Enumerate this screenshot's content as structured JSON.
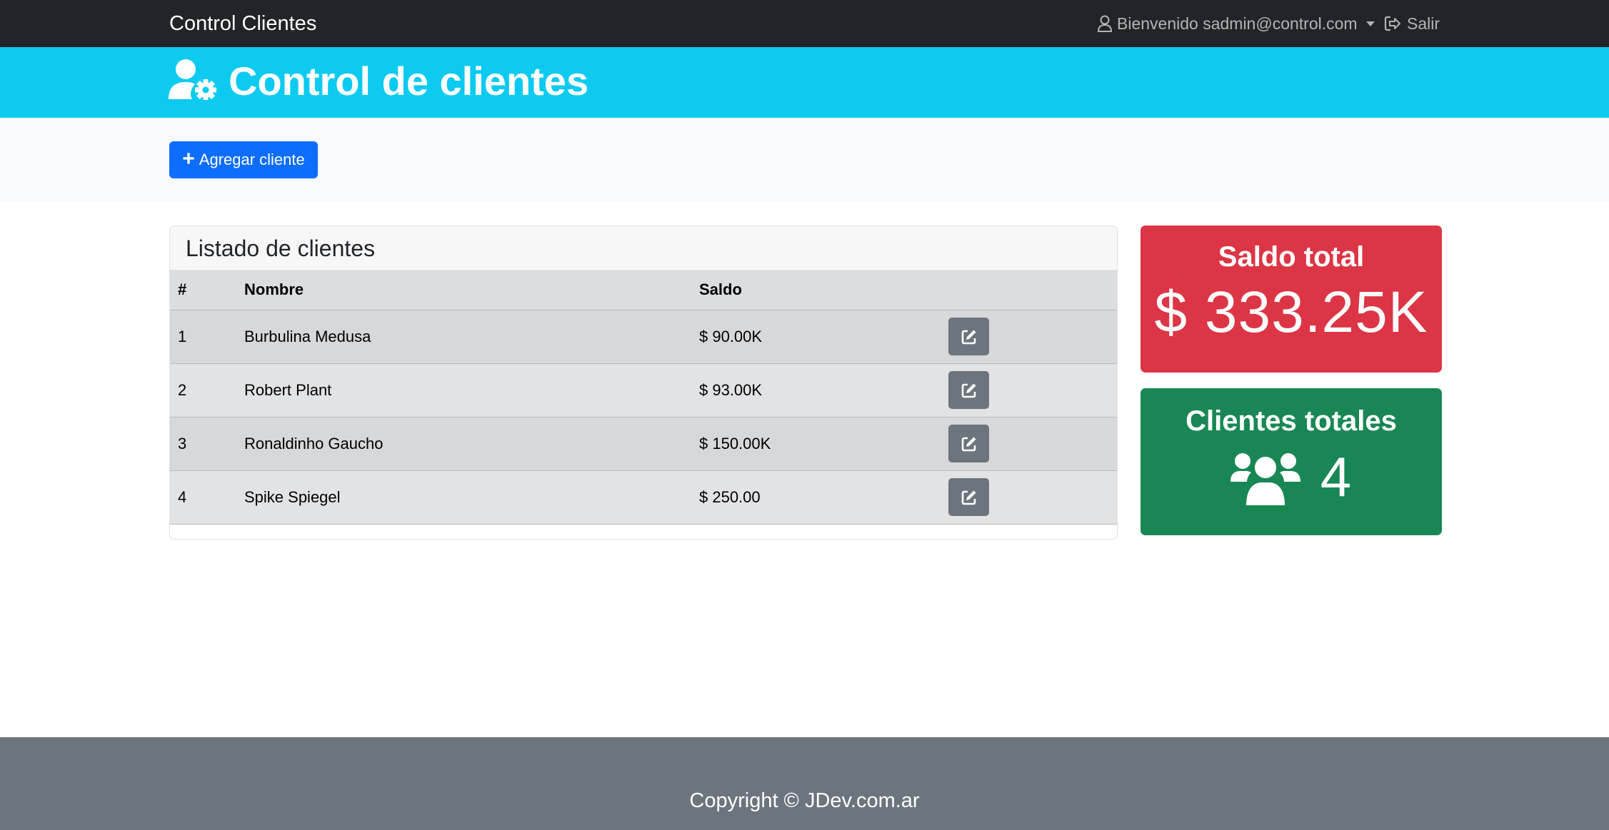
{
  "navbar": {
    "brand": "Control Clientes",
    "user_label": "Bienvenido sadmin@control.com",
    "logout_label": "Salir"
  },
  "header": {
    "title": "Control de clientes"
  },
  "actions": {
    "add_label": "Agregar cliente"
  },
  "clients_card": {
    "title": "Listado de clientes",
    "columns": [
      "#",
      "Nombre",
      "Saldo",
      ""
    ],
    "rows": [
      {
        "num": "1",
        "name": "Burbulina Medusa",
        "balance": "$ 90.00K"
      },
      {
        "num": "2",
        "name": "Robert Plant",
        "balance": "$ 93.00K"
      },
      {
        "num": "3",
        "name": "Ronaldinho Gaucho",
        "balance": "$ 150.00K"
      },
      {
        "num": "4",
        "name": "Spike Spiegel",
        "balance": "$ 250.00"
      }
    ]
  },
  "stats": {
    "balance_title": "Saldo total",
    "balance_value": "$ 333.25K",
    "clients_title": "Clientes totales",
    "clients_value": "4"
  },
  "footer": {
    "text": "Copyright © JDev.com.ar"
  },
  "colors": {
    "navbar": "#212529",
    "header": "#0dcaf0",
    "primary": "#0d6efd",
    "danger": "#dc3545",
    "success": "#198754",
    "secondary": "#6c757d"
  },
  "icons": {
    "user": "user-outline-icon",
    "logout": "logout-icon",
    "header": "user-gear-icon",
    "add": "plus-icon",
    "edit": "edit-icon",
    "clients": "users-group-icon"
  }
}
